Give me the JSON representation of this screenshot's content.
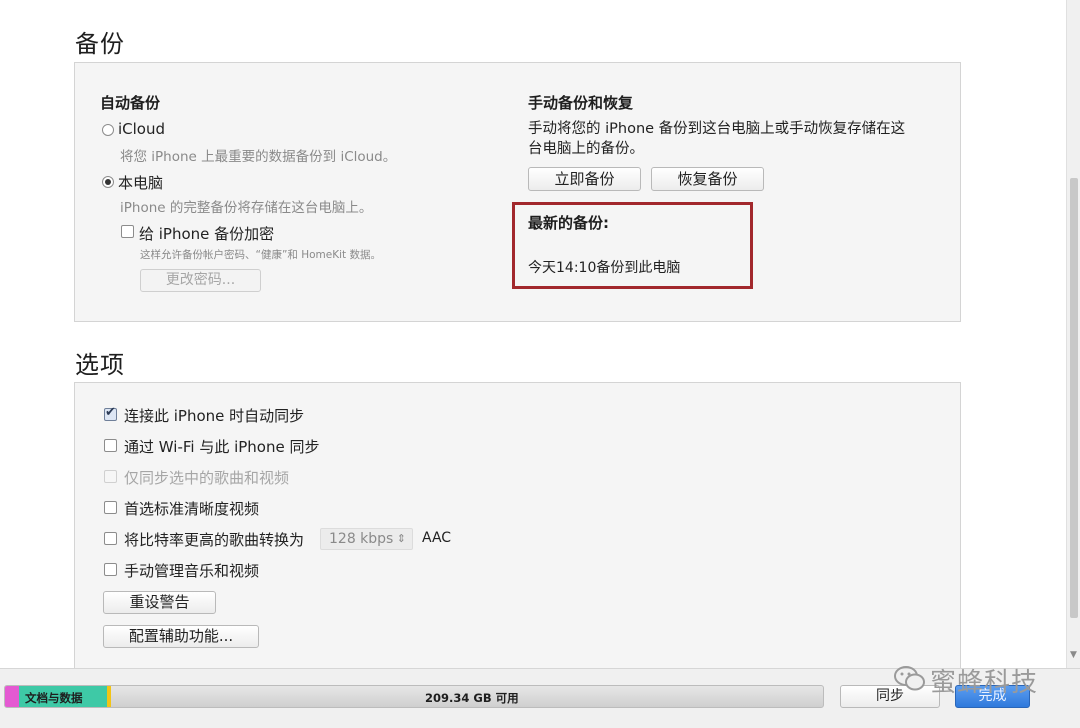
{
  "backup": {
    "section_title": "备份",
    "auto": {
      "heading": "自动备份",
      "icloud_label": "iCloud",
      "icloud_desc": "将您 iPhone 上最重要的数据备份到 iCloud。",
      "icloud_selected": false,
      "computer_label": "本电脑",
      "computer_desc": "iPhone 的完整备份将存储在这台电脑上。",
      "computer_selected": true,
      "encrypt_label": "给 iPhone 备份加密",
      "encrypt_checked": false,
      "encrypt_desc": "这样允许备份帐户密码、“健康”和 HomeKit 数据。",
      "change_password_label": "更改密码..."
    },
    "manual": {
      "heading": "手动备份和恢复",
      "desc_line1": "手动将您的 iPhone 备份到这台电脑上或手动恢复存储在这",
      "desc_line2": "台电脑上的备份。",
      "backup_now_label": "立即备份",
      "restore_label": "恢复备份",
      "latest_heading": "最新的备份:",
      "latest_value": "今天14:10备份到此电脑"
    }
  },
  "options": {
    "section_title": "选项",
    "items": [
      {
        "label": "连接此 iPhone 时自动同步",
        "checked": true,
        "enabled": true
      },
      {
        "label": "通过 Wi-Fi 与此 iPhone 同步",
        "checked": false,
        "enabled": true
      },
      {
        "label": "仅同步选中的歌曲和视频",
        "checked": false,
        "enabled": false
      },
      {
        "label": "首选标准清晰度视频",
        "checked": false,
        "enabled": true
      },
      {
        "label": "将比特率更高的歌曲转换为",
        "checked": false,
        "enabled": true
      },
      {
        "label": "手动管理音乐和视频",
        "checked": false,
        "enabled": true
      }
    ],
    "bitrate_value": "128 kbps",
    "bitrate_format": "AAC",
    "reset_warnings_label": "重设警告",
    "accessibility_label": "配置辅助功能..."
  },
  "footer": {
    "storage_category": "文档与数据",
    "storage_free": "209.34 GB 可用",
    "sync_label": "同步",
    "done_label": "完成",
    "watermark": "蜜蜂科技"
  },
  "colors": {
    "highlight_border": "#a2282c",
    "storage_pink": "#e45ad2",
    "storage_teal": "#3ec9a6",
    "storage_yellow": "#f2c416",
    "done_blue": "#2f79dc"
  }
}
